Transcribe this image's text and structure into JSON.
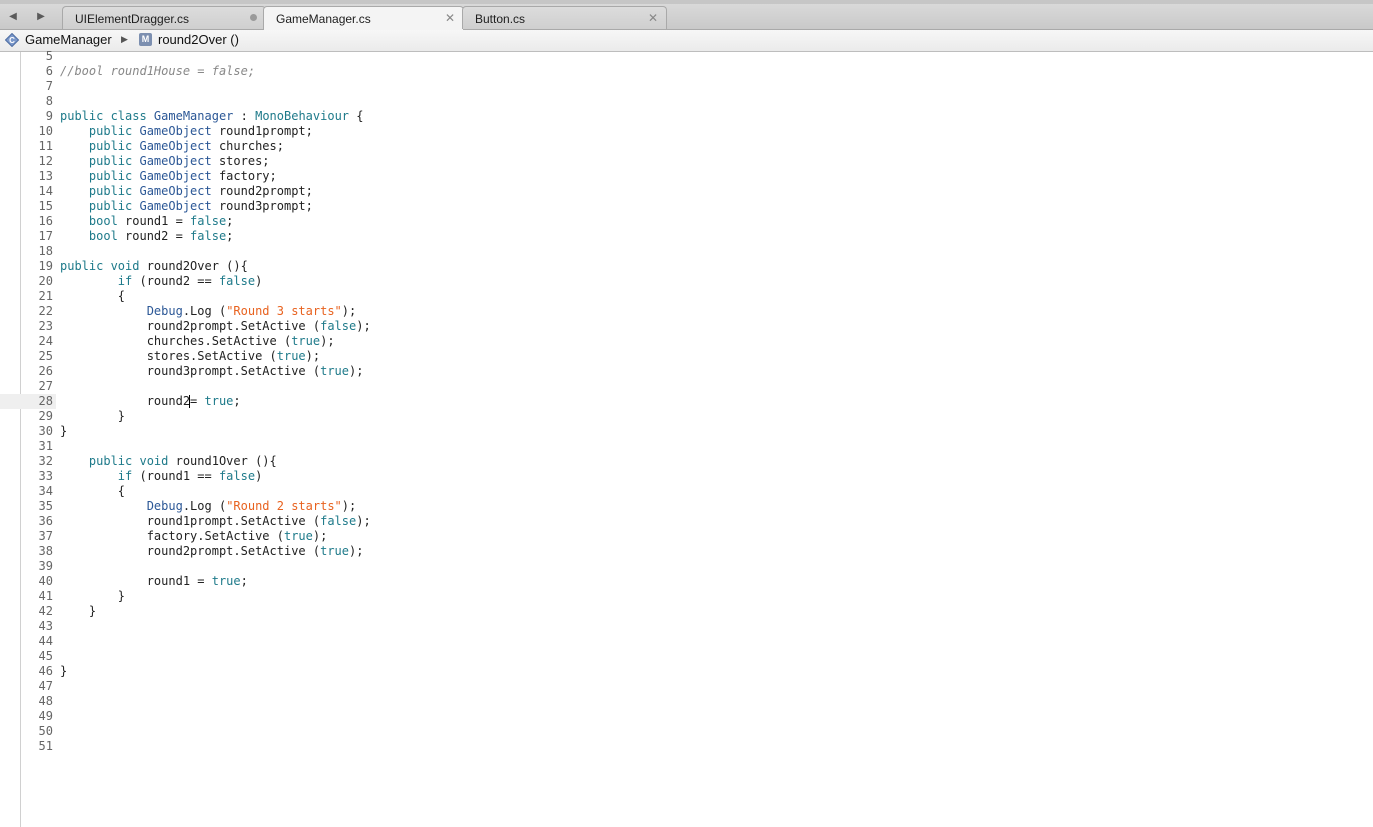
{
  "nav": {
    "back_icon": "back-arrow-icon",
    "forward_icon": "forward-arrow-icon",
    "back_glyph": "◀",
    "forward_glyph": "▶"
  },
  "tabs": [
    {
      "label": "UIElementDragger.cs",
      "active": false,
      "indicator": "unsaved-dot"
    },
    {
      "label": "GameManager.cs",
      "active": true,
      "indicator": "close",
      "close_glyph": "✕"
    },
    {
      "label": "Button.cs",
      "active": false,
      "indicator": "close",
      "close_glyph": "✕"
    }
  ],
  "breadcrumb": {
    "class_icon": "class-icon",
    "class_name": "GameManager",
    "separator": "▶",
    "method_icon": "method-icon",
    "method_icon_letter": "M",
    "method_name": "round2Over ()"
  },
  "colors": {
    "keyword": "#1e7a8a",
    "type": "#2b5796",
    "string": "#e8621f",
    "comment": "#888888",
    "plain": "#222222"
  },
  "editor": {
    "current_line": 28,
    "cursor_after": "round2",
    "lines": [
      {
        "n": "5",
        "tokens": []
      },
      {
        "n": "6",
        "tokens": [
          {
            "t": "//bool round1House = false;",
            "c": "cmt"
          }
        ]
      },
      {
        "n": "7",
        "tokens": []
      },
      {
        "n": "8",
        "tokens": []
      },
      {
        "n": "9",
        "tokens": [
          {
            "t": "public class ",
            "c": "kw"
          },
          {
            "t": "GameManager",
            "c": "type"
          },
          {
            "t": " : ",
            "c": "plain"
          },
          {
            "t": "MonoBehaviour",
            "c": "kw"
          },
          {
            "t": " {",
            "c": "plain"
          }
        ]
      },
      {
        "n": "10",
        "tokens": [
          {
            "t": "    public ",
            "c": "kw"
          },
          {
            "t": "GameObject",
            "c": "type"
          },
          {
            "t": " round1prompt;",
            "c": "plain"
          }
        ]
      },
      {
        "n": "11",
        "tokens": [
          {
            "t": "    public ",
            "c": "kw"
          },
          {
            "t": "GameObject",
            "c": "type"
          },
          {
            "t": " churches;",
            "c": "plain"
          }
        ]
      },
      {
        "n": "12",
        "tokens": [
          {
            "t": "    public ",
            "c": "kw"
          },
          {
            "t": "GameObject",
            "c": "type"
          },
          {
            "t": " stores;",
            "c": "plain"
          }
        ]
      },
      {
        "n": "13",
        "tokens": [
          {
            "t": "    public ",
            "c": "kw"
          },
          {
            "t": "GameObject",
            "c": "type"
          },
          {
            "t": " factory;",
            "c": "plain"
          }
        ]
      },
      {
        "n": "14",
        "tokens": [
          {
            "t": "    public ",
            "c": "kw"
          },
          {
            "t": "GameObject",
            "c": "type"
          },
          {
            "t": " round2prompt;",
            "c": "plain"
          }
        ]
      },
      {
        "n": "15",
        "tokens": [
          {
            "t": "    public ",
            "c": "kw"
          },
          {
            "t": "GameObject",
            "c": "type"
          },
          {
            "t": " round3prompt;",
            "c": "plain"
          }
        ]
      },
      {
        "n": "16",
        "tokens": [
          {
            "t": "    bool",
            "c": "kw"
          },
          {
            "t": " round1 = ",
            "c": "plain"
          },
          {
            "t": "false",
            "c": "kw"
          },
          {
            "t": ";",
            "c": "plain"
          }
        ]
      },
      {
        "n": "17",
        "tokens": [
          {
            "t": "    bool",
            "c": "kw"
          },
          {
            "t": " round2 = ",
            "c": "plain"
          },
          {
            "t": "false",
            "c": "kw"
          },
          {
            "t": ";",
            "c": "plain"
          }
        ]
      },
      {
        "n": "18",
        "tokens": []
      },
      {
        "n": "19",
        "tokens": [
          {
            "t": "public void",
            "c": "kw"
          },
          {
            "t": " round2Over (){",
            "c": "plain"
          }
        ]
      },
      {
        "n": "20",
        "tokens": [
          {
            "t": "        if",
            "c": "kw"
          },
          {
            "t": " (round2 == ",
            "c": "plain"
          },
          {
            "t": "false",
            "c": "kw"
          },
          {
            "t": ")",
            "c": "plain"
          }
        ]
      },
      {
        "n": "21",
        "tokens": [
          {
            "t": "        {",
            "c": "plain"
          }
        ]
      },
      {
        "n": "22",
        "tokens": [
          {
            "t": "            ",
            "c": "plain"
          },
          {
            "t": "Debug",
            "c": "type"
          },
          {
            "t": ".Log (",
            "c": "plain"
          },
          {
            "t": "\"Round 3 starts\"",
            "c": "str"
          },
          {
            "t": ");",
            "c": "plain"
          }
        ]
      },
      {
        "n": "23",
        "tokens": [
          {
            "t": "            round2prompt.SetActive (",
            "c": "plain"
          },
          {
            "t": "false",
            "c": "kw"
          },
          {
            "t": ");",
            "c": "plain"
          }
        ]
      },
      {
        "n": "24",
        "tokens": [
          {
            "t": "            churches.SetActive (",
            "c": "plain"
          },
          {
            "t": "true",
            "c": "kw"
          },
          {
            "t": ");",
            "c": "plain"
          }
        ]
      },
      {
        "n": "25",
        "tokens": [
          {
            "t": "            stores.SetActive (",
            "c": "plain"
          },
          {
            "t": "true",
            "c": "kw"
          },
          {
            "t": ");",
            "c": "plain"
          }
        ]
      },
      {
        "n": "26",
        "tokens": [
          {
            "t": "            round3prompt.SetActive (",
            "c": "plain"
          },
          {
            "t": "true",
            "c": "kw"
          },
          {
            "t": ");",
            "c": "plain"
          }
        ]
      },
      {
        "n": "27",
        "tokens": []
      },
      {
        "n": "28",
        "tokens": [
          {
            "t": "            round2",
            "c": "plain"
          },
          {
            "t": "",
            "c": "cursor"
          },
          {
            "t": "= ",
            "c": "plain"
          },
          {
            "t": "true",
            "c": "kw"
          },
          {
            "t": ";",
            "c": "plain"
          }
        ]
      },
      {
        "n": "29",
        "tokens": [
          {
            "t": "        }",
            "c": "plain"
          }
        ]
      },
      {
        "n": "30",
        "tokens": [
          {
            "t": "}",
            "c": "plain"
          }
        ]
      },
      {
        "n": "31",
        "tokens": []
      },
      {
        "n": "32",
        "tokens": [
          {
            "t": "    public void",
            "c": "kw"
          },
          {
            "t": " round1Over (){",
            "c": "plain"
          }
        ]
      },
      {
        "n": "33",
        "tokens": [
          {
            "t": "        if",
            "c": "kw"
          },
          {
            "t": " (round1 == ",
            "c": "plain"
          },
          {
            "t": "false",
            "c": "kw"
          },
          {
            "t": ")",
            "c": "plain"
          }
        ]
      },
      {
        "n": "34",
        "tokens": [
          {
            "t": "        {",
            "c": "plain"
          }
        ]
      },
      {
        "n": "35",
        "tokens": [
          {
            "t": "            ",
            "c": "plain"
          },
          {
            "t": "Debug",
            "c": "type"
          },
          {
            "t": ".Log (",
            "c": "plain"
          },
          {
            "t": "\"Round 2 starts\"",
            "c": "str"
          },
          {
            "t": ");",
            "c": "plain"
          }
        ]
      },
      {
        "n": "36",
        "tokens": [
          {
            "t": "            round1prompt.SetActive (",
            "c": "plain"
          },
          {
            "t": "false",
            "c": "kw"
          },
          {
            "t": ");",
            "c": "plain"
          }
        ]
      },
      {
        "n": "37",
        "tokens": [
          {
            "t": "            factory.SetActive (",
            "c": "plain"
          },
          {
            "t": "true",
            "c": "kw"
          },
          {
            "t": ");",
            "c": "plain"
          }
        ]
      },
      {
        "n": "38",
        "tokens": [
          {
            "t": "            round2prompt.SetActive (",
            "c": "plain"
          },
          {
            "t": "true",
            "c": "kw"
          },
          {
            "t": ");",
            "c": "plain"
          }
        ]
      },
      {
        "n": "39",
        "tokens": []
      },
      {
        "n": "40",
        "tokens": [
          {
            "t": "            round1 = ",
            "c": "plain"
          },
          {
            "t": "true",
            "c": "kw"
          },
          {
            "t": ";",
            "c": "plain"
          }
        ]
      },
      {
        "n": "41",
        "tokens": [
          {
            "t": "        }",
            "c": "plain"
          }
        ]
      },
      {
        "n": "42",
        "tokens": [
          {
            "t": "    }",
            "c": "plain"
          }
        ]
      },
      {
        "n": "43",
        "tokens": []
      },
      {
        "n": "44",
        "tokens": []
      },
      {
        "n": "45",
        "tokens": []
      },
      {
        "n": "46",
        "tokens": [
          {
            "t": "}",
            "c": "plain"
          }
        ]
      },
      {
        "n": "47",
        "tokens": []
      },
      {
        "n": "48",
        "tokens": []
      },
      {
        "n": "49",
        "tokens": []
      },
      {
        "n": "50",
        "tokens": []
      },
      {
        "n": "51",
        "tokens": []
      }
    ]
  }
}
